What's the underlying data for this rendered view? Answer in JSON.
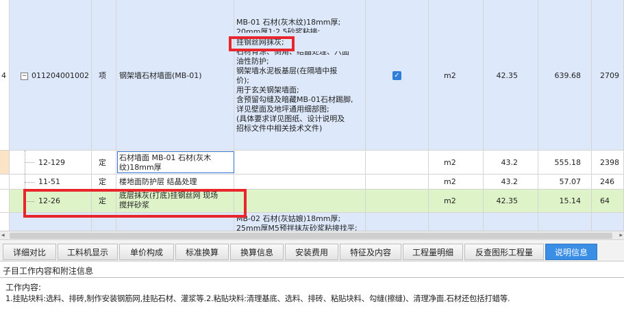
{
  "rows": [
    {
      "num": "4",
      "code": "011204001002",
      "type": "项",
      "name": "钢架墙石材墙面(MB-01)",
      "features": [
        "MB-01 石材(灰木纹)18mm厚;",
        "20mm厚1:2.5砂浆粘接;",
        "挂钢丝网抹灰;",
        "石材背涂、倒角、结晶处理、六面",
        "油性防护;",
        "钢架墙水泥板基层(在隔墙中报",
        "价);",
        "用于玄关钢架墙面;",
        "含预留勾缝及暗藏MB-01石材踢脚,",
        "详见壁面及地坪通用细部图;",
        "(具体要求详见图纸、设计说明及",
        "招标文件中相关技术文件)"
      ],
      "unit": "m2",
      "qty": "42.35",
      "price": "639.68",
      "total": "2709"
    },
    {
      "code": "12-129",
      "type": "定",
      "name_lines": [
        "石材墙面 MB-01 石材(灰木",
        "纹)18mm厚"
      ],
      "unit": "m2",
      "qty": "43.2",
      "price": "555.18",
      "total": "2398"
    },
    {
      "code": "11-51",
      "type": "定",
      "name_lines": [
        "楼地面防护层 结晶处理"
      ],
      "unit": "m2",
      "qty": "43.2",
      "price": "57.07",
      "total": "246"
    },
    {
      "code": "12-26",
      "type": "定",
      "name_lines": [
        "底层抹灰(打底)挂钢丝网 现场",
        "搅拌砂浆"
      ],
      "unit": "m2",
      "qty": "42.35",
      "price": "15.14",
      "total": "64"
    },
    {
      "features": [
        "MB-02 石材(灰姑娘)18mm厚;",
        "25mm厚M5预拌抹灰砂浆粘接找平;"
      ]
    }
  ],
  "tabs": [
    "详细对比",
    "工料机显示",
    "单价构成",
    "标准换算",
    "换算信息",
    "安装费用",
    "特征及内容",
    "工程量明细",
    "反查图形工程量",
    "说明信息"
  ],
  "active_tab": "说明信息",
  "section_title": "子目工作内容和附注信息",
  "info": {
    "heading": "工作内容:",
    "line": "1.挂贴块料:选料、排砖,制作安装钢筋网,挂贴石材、灌浆等.2.粘贴块料:清理基底、选料、排砖、粘贴块料、勾缝(擦缝)、清理净面.石材还包括打蜡等."
  }
}
